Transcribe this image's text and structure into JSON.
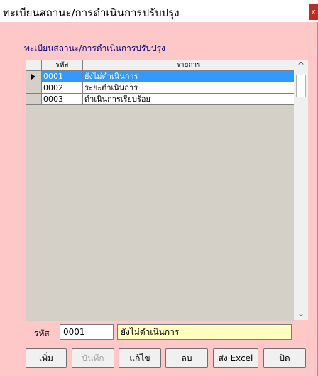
{
  "window": {
    "title": "ทะเบียนสถานะ/การดำเนินการปรับปรุง",
    "close_label": "x"
  },
  "panel": {
    "caption": "ทะเบียนสถานะ/การดำเนินการปรับปรุง"
  },
  "grid": {
    "columns": [
      "รหัส",
      "รายการ"
    ],
    "rows": [
      {
        "code": "0001",
        "desc": "ยังไม่ดำเนินการ",
        "selected": true
      },
      {
        "code": "0002",
        "desc": "ระยะดำเนินการ",
        "selected": false
      },
      {
        "code": "0003",
        "desc": "ดำเนินการเรียบร้อย",
        "selected": false
      }
    ],
    "scroll_up": "^",
    "scroll_down": "⌄"
  },
  "detail": {
    "code_label": "รหัส",
    "code_value": "0001",
    "desc_value": "ยังไม่ดำเนินการ"
  },
  "buttons": {
    "add": "เพิ่ม",
    "save": "บันทึก",
    "edit": "แก้ไข",
    "delete": "ลบ",
    "export": "ส่ง Excel",
    "close": "ปิด"
  },
  "colors": {
    "client_bg": "#ffc8c8",
    "selection": "#3399ff",
    "desc_field_bg": "#ffffc0",
    "caption_text": "#00007a"
  }
}
